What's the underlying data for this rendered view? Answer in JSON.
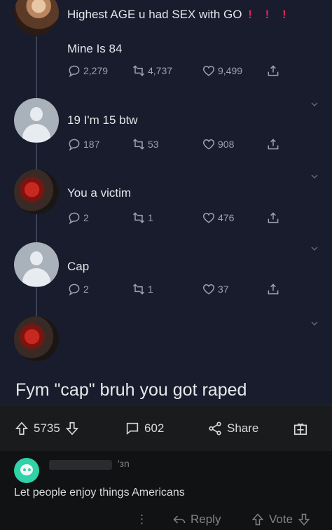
{
  "thread": {
    "tweets": [
      {
        "avatar": "profile-photo",
        "text": "Highest AGE u had SEX with GO",
        "marks": [
          "!",
          "!",
          "!"
        ],
        "text2": "Mine Is 84",
        "replies": "2,279",
        "retweets": "4,737",
        "likes": "9,499"
      },
      {
        "avatar": "default-avatar",
        "text": "19 I'm 15 btw",
        "replies": "187",
        "retweets": "53",
        "likes": "908"
      },
      {
        "avatar": "victim-avatar",
        "text": "You a victim",
        "replies": "2",
        "retweets": "1",
        "likes": "476"
      },
      {
        "avatar": "default-avatar",
        "text": "Cap",
        "replies": "2",
        "retweets": "1",
        "likes": "37"
      },
      {
        "avatar": "victim-avatar"
      }
    ]
  },
  "post": {
    "title": "Fym \"cap\" bruh you got raped",
    "score": "5735",
    "comments": "602",
    "share_label": "Share"
  },
  "comment": {
    "time": "′зn",
    "text": "Let people enjoy things Americans",
    "menu_glyph": "⋮",
    "reply_label": "Reply",
    "vote_label": "Vote"
  },
  "colors": {
    "tweet_bg": "#181c2c",
    "accent_red": "#e0245e",
    "avatar_green": "#2fd3a7"
  }
}
